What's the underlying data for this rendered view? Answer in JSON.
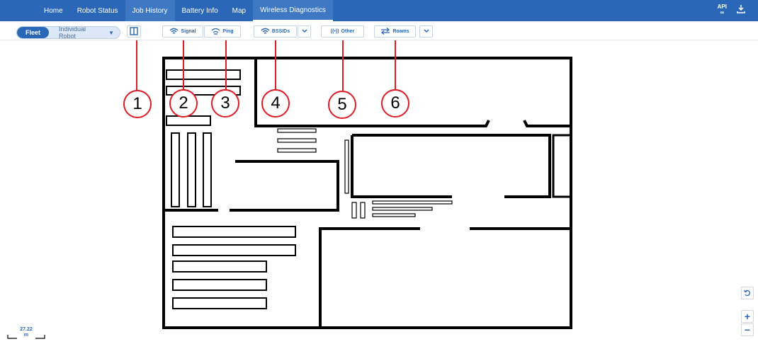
{
  "nav": {
    "tabs": [
      {
        "label": "Home"
      },
      {
        "label": "Robot Status"
      },
      {
        "label": "Job History"
      },
      {
        "label": "Battery Info"
      },
      {
        "label": "Map"
      },
      {
        "label": "Wireless Diagnostics"
      }
    ],
    "api_label": "API",
    "download_icon": "download-icon"
  },
  "toolbar": {
    "fleet_label": "Fleet",
    "individual_robot_label": "Individual Robot",
    "signal_label": "Signal",
    "ping_label": "Ping",
    "bssids_label": "BSSIDs",
    "other_label": "Other",
    "roams_label": "Roams"
  },
  "callouts": [
    "1",
    "2",
    "3",
    "4",
    "5",
    "6"
  ],
  "colors": {
    "brand": "#2a67b6",
    "callout": "#e01b24"
  },
  "scale": {
    "value": "27.22",
    "unit": "m"
  }
}
